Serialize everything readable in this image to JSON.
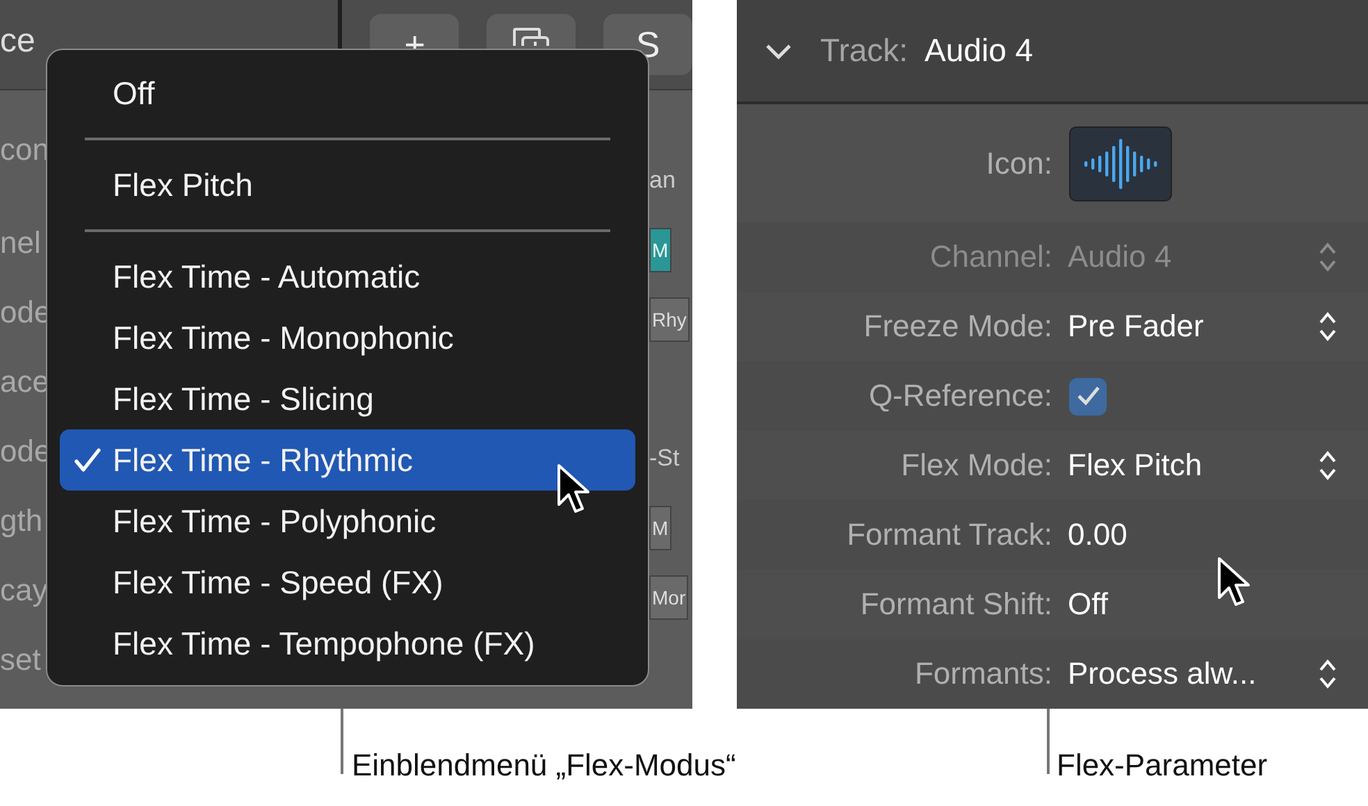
{
  "background": {
    "title": "ce",
    "toolbar": [
      {
        "kind": "text",
        "label": "+"
      },
      {
        "kind": "icon"
      },
      {
        "kind": "text",
        "label": "S"
      }
    ],
    "left_fragments": [
      "con",
      "nel",
      "ode",
      "ace",
      "ode",
      "gth",
      "cay",
      "set"
    ],
    "right_fragments": [
      {
        "kind": "text",
        "label": "an"
      },
      {
        "kind": "toggle",
        "label": "M",
        "on": true
      },
      {
        "kind": "popup",
        "label": "Rhy"
      },
      {
        "kind": "text",
        "label": "-St"
      },
      {
        "kind": "toggle",
        "label": "M",
        "on": false
      },
      {
        "kind": "popup",
        "label": "Mor"
      }
    ]
  },
  "menu": {
    "items": [
      {
        "label": "Off",
        "selected": false,
        "separator_after": true
      },
      {
        "label": "Flex Pitch",
        "selected": false,
        "separator_after": true
      },
      {
        "label": "Flex Time - Automatic",
        "selected": false,
        "separator_after": false
      },
      {
        "label": "Flex Time - Monophonic",
        "selected": false,
        "separator_after": false
      },
      {
        "label": "Flex Time - Slicing",
        "selected": false,
        "separator_after": false
      },
      {
        "label": "Flex Time - Rhythmic",
        "selected": true,
        "separator_after": false
      },
      {
        "label": "Flex Time - Polyphonic",
        "selected": false,
        "separator_after": false
      },
      {
        "label": "Flex Time - Speed (FX)",
        "selected": false,
        "separator_after": false
      },
      {
        "label": "Flex Time - Tempophone (FX)",
        "selected": false,
        "separator_after": false
      }
    ]
  },
  "inspector": {
    "header": {
      "expanded": true,
      "label": "Track:",
      "value": "Audio 4"
    },
    "rows": [
      {
        "kind": "icon",
        "label": "Icon:"
      },
      {
        "kind": "popup",
        "label": "Channel:",
        "value": "Audio 4",
        "disabled": true
      },
      {
        "kind": "popup",
        "label": "Freeze Mode:",
        "value": "Pre Fader",
        "disabled": false
      },
      {
        "kind": "checkbox",
        "label": "Q-Reference:",
        "checked": true
      },
      {
        "kind": "popup",
        "label": "Flex Mode:",
        "value": "Flex Pitch",
        "disabled": false
      },
      {
        "kind": "value",
        "label": "Formant Track:",
        "value": "0.00"
      },
      {
        "kind": "value",
        "label": "Formant Shift:",
        "value": "Off"
      },
      {
        "kind": "popup",
        "label": "Formants:",
        "value": "Process alw...",
        "disabled": false
      }
    ]
  },
  "callouts": [
    "Einblendmenü „Flex-Modus“",
    "Flex-Parameter"
  ]
}
